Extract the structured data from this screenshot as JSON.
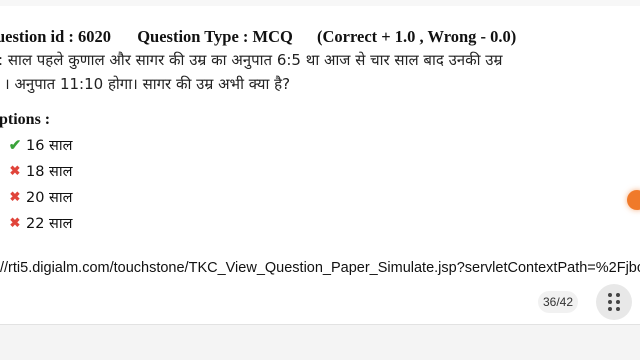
{
  "question": {
    "id_text": "uestion id : 6020",
    "type_text": "Question Type : MCQ",
    "marks_text": "(Correct + 1.0 , Wrong - 0.0)",
    "line1": ": साल पहले कुणाल और सागर की उम्र का अनुपात 6:5 था आज से चार साल बाद उनकी उम्र",
    "line2": "। अनुपात 11:10  होगा। सागर की उम्र अभी क्या है?"
  },
  "options_label": "ptions :",
  "options": [
    {
      "text": "16 साल",
      "status": "correct",
      "icon": "check-icon"
    },
    {
      "text": "18 साल",
      "status": "wrong",
      "icon": "cross-icon"
    },
    {
      "text": "20 साल",
      "status": "wrong",
      "icon": "cross-icon"
    },
    {
      "text": "22 साल",
      "status": "wrong",
      "icon": "cross-icon"
    }
  ],
  "url": "//rti5.digialm.com/touchstone/TKC_View_Question_Paper_Simulate.jsp?servletContextPath=%2Fjbc",
  "pager": {
    "text": "36/42"
  },
  "colors": {
    "correct": "#3aa33a",
    "wrong": "#e0443a",
    "accent_dot": "#f07a2a"
  }
}
